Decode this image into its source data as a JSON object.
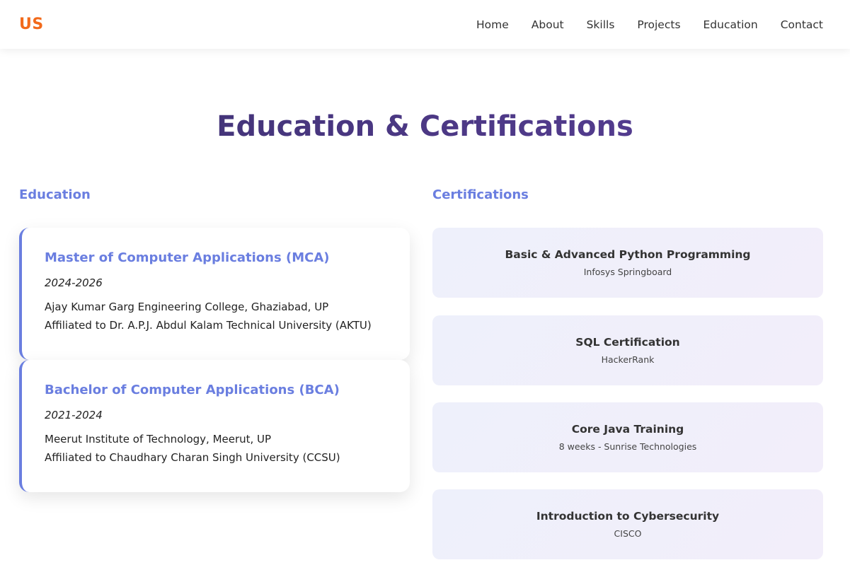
{
  "nav": {
    "logo": "US",
    "links": [
      "Home",
      "About",
      "Skills",
      "Projects",
      "Education",
      "Contact"
    ]
  },
  "section": {
    "title": "Education & Certifications"
  },
  "education": {
    "heading": "Education",
    "items": [
      {
        "degree": "Master of Computer Applications (MCA)",
        "years": "2024-2026",
        "institution": "Ajay Kumar Garg Engineering College, Ghaziabad, UP",
        "affiliation": "Affiliated to Dr. A.P.J. Abdul Kalam Technical University (AKTU)"
      },
      {
        "degree": "Bachelor of Computer Applications (BCA)",
        "years": "2021-2024",
        "institution": "Meerut Institute of Technology, Meerut, UP",
        "affiliation": "Affiliated to Chaudhary Charan Singh University (CCSU)"
      }
    ]
  },
  "certifications": {
    "heading": "Certifications",
    "items": [
      {
        "title": "Basic & Advanced Python Programming",
        "issuer": "Infosys Springboard"
      },
      {
        "title": "SQL Certification",
        "issuer": "HackerRank"
      },
      {
        "title": "Core Java Training",
        "issuer": "8 weeks - Sunrise Technologies"
      },
      {
        "title": "Introduction to Cybersecurity",
        "issuer": "CISCO"
      }
    ]
  },
  "colors": {
    "logo": "#f26a1b",
    "accent": "#6a7ee0",
    "title": "#4b3a87"
  }
}
